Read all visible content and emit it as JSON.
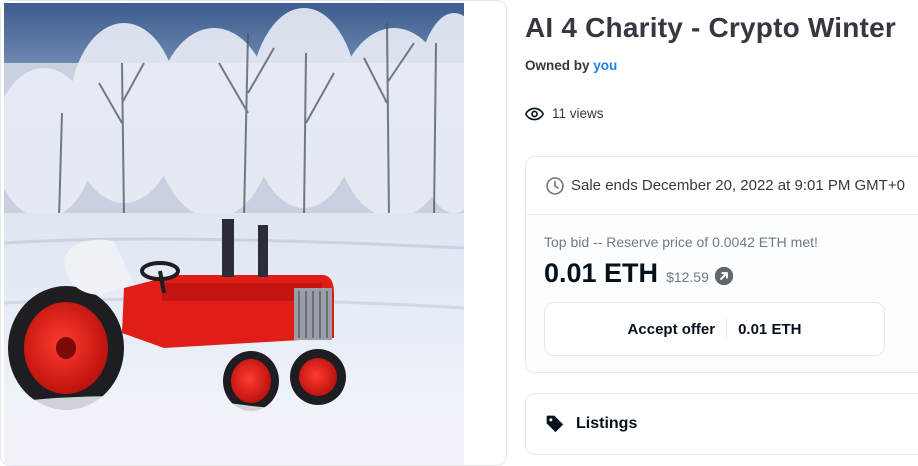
{
  "nft": {
    "title": "AI 4 Charity - Crypto Winter",
    "owned_by_label": "Owned by",
    "owner": "you",
    "views": "11 views",
    "image_icon": "tractor-in-snow-artwork"
  },
  "sale": {
    "ends_text": "Sale ends December 20, 2022 at 9:01 PM GMT+0",
    "top_bid_text": "Top bid -- Reserve price of 0.0042 ETH met!",
    "price_eth": "0.01 ETH",
    "price_usd": "$12.59",
    "accept_offer_label": "Accept offer",
    "accept_offer_amount": "0.01 ETH"
  },
  "listings": {
    "label": "Listings"
  },
  "colors": {
    "link": "#2081e2",
    "text_primary": "#04111d",
    "text_secondary": "#707a83",
    "border": "#e5e8eb"
  }
}
